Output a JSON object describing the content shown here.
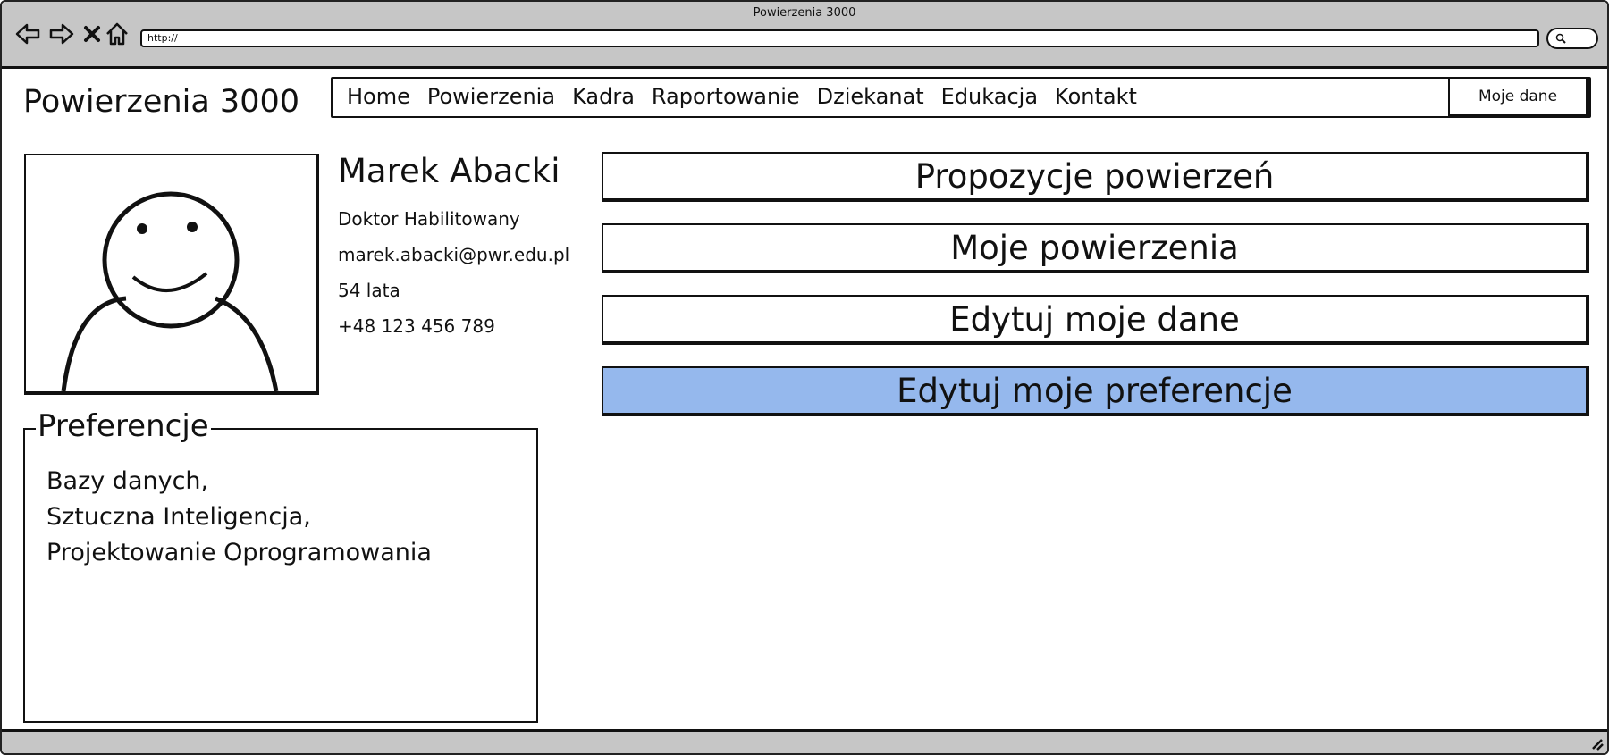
{
  "browser": {
    "title": "Powierzenia 3000",
    "url": "http://"
  },
  "site": {
    "brand": "Powierzenia 3000",
    "menu": [
      "Home",
      "Powierzenia",
      "Kadra",
      "Raportowanie",
      "Dziekanat",
      "Edukacja",
      "Kontakt"
    ],
    "moje_dane": "Moje dane"
  },
  "profile": {
    "name": "Marek Abacki",
    "degree": "Doktor Habilitowany",
    "email": "marek.abacki@pwr.edu.pl",
    "age": "54 lata",
    "phone": "+48 123 456 789"
  },
  "preferences": {
    "legend": "Preferencje",
    "items": [
      "Bazy danych,",
      "Sztuczna Inteligencja,",
      "Projektowanie Oprogramowania"
    ]
  },
  "actions": {
    "proposals": "Propozycje powierzeń",
    "my_assignments": "Moje powierzenia",
    "edit_data": "Edytuj moje dane",
    "edit_preferences": "Edytuj moje preferencje"
  }
}
